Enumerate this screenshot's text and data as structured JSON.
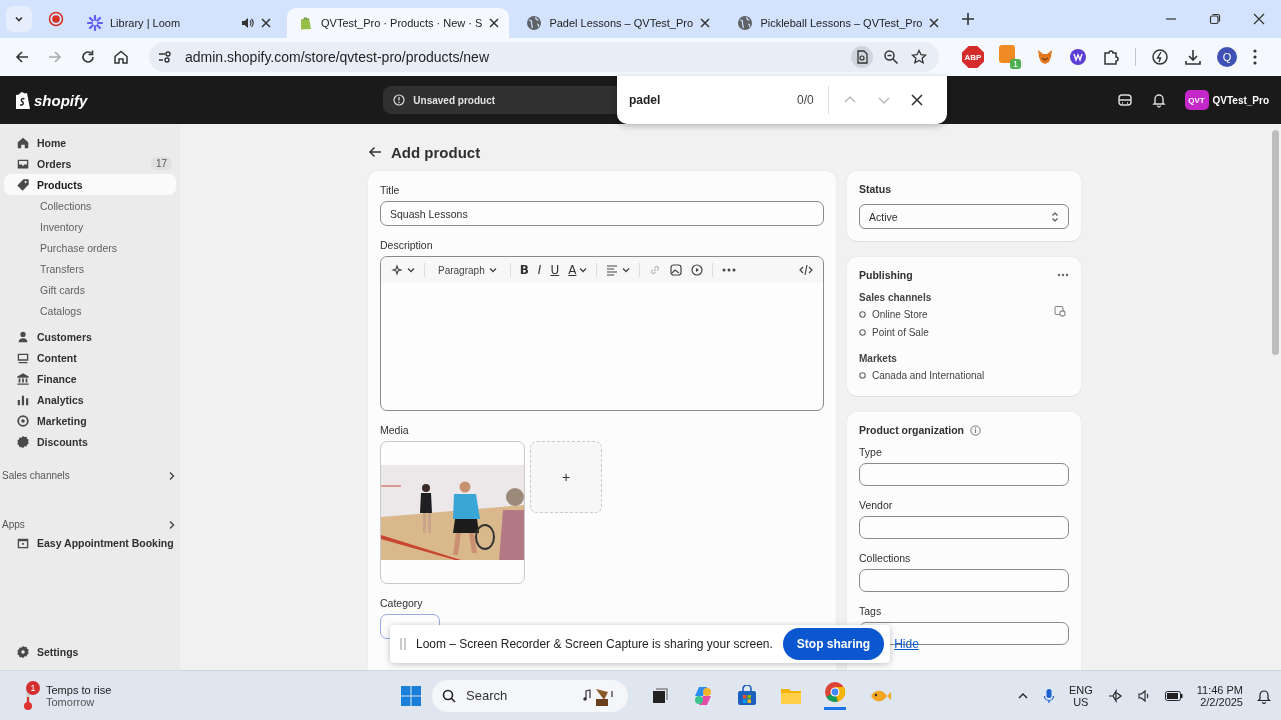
{
  "browser": {
    "tabs": [
      {
        "title": "Library | Loom",
        "kind": "loom",
        "selected": false,
        "audio": true
      },
      {
        "title": "QVTest_Pro · Products · New · S",
        "kind": "shopify",
        "selected": true,
        "audio": false
      },
      {
        "title": "Padel Lessons – QVTest_Pro",
        "kind": "globe",
        "selected": false,
        "audio": false
      },
      {
        "title": "Pickleball Lessons – QVTest_Pro",
        "kind": "globe",
        "selected": false,
        "audio": false
      }
    ],
    "url": "admin.shopify.com/store/qvtest-pro/products/new",
    "abp": "ABP",
    "extension_badge": "1",
    "profile": "Q"
  },
  "find_bar": {
    "query": "padel",
    "count": "0/0"
  },
  "topbar": {
    "logo": "shopify",
    "unsaved": "Unsaved product",
    "store_badge": "QVT",
    "store": "QVTest_Pro"
  },
  "sidebar": {
    "nav": [
      {
        "label": "Home",
        "kind": "main",
        "selected": false
      },
      {
        "label": "Orders",
        "kind": "main",
        "selected": false,
        "badge": "17"
      },
      {
        "label": "Products",
        "kind": "main",
        "selected": true
      },
      {
        "label": "Collections",
        "kind": "sub",
        "selected": false
      },
      {
        "label": "Inventory",
        "kind": "sub",
        "selected": false
      },
      {
        "label": "Purchase orders",
        "kind": "sub",
        "selected": false
      },
      {
        "label": "Transfers",
        "kind": "sub",
        "selected": false
      },
      {
        "label": "Gift cards",
        "kind": "sub",
        "selected": false
      },
      {
        "label": "Catalogs",
        "kind": "sub",
        "selected": false
      },
      {
        "label": "Customers",
        "kind": "main",
        "selected": false
      },
      {
        "label": "Content",
        "kind": "main",
        "selected": false
      },
      {
        "label": "Finance",
        "kind": "main",
        "selected": false
      },
      {
        "label": "Analytics",
        "kind": "main",
        "selected": false
      },
      {
        "label": "Marketing",
        "kind": "main",
        "selected": false
      },
      {
        "label": "Discounts",
        "kind": "main",
        "selected": false
      }
    ],
    "sections": [
      {
        "label": "Sales channels"
      },
      {
        "label": "Apps",
        "items": [
          {
            "label": "Easy Appointment Booking",
            "selected": false
          }
        ]
      }
    ],
    "settings": "Settings"
  },
  "page": {
    "title": "Add product"
  },
  "product": {
    "title_label": "Title",
    "title_value": "Squash Lessons",
    "description_label": "Description",
    "block_format": "Paragraph",
    "format_buttons": [
      "B",
      "I",
      "U",
      "A"
    ],
    "media_label": "Media",
    "add_media": "+",
    "category_label": "Category"
  },
  "status": {
    "label": "Status",
    "value": "Active"
  },
  "publishing": {
    "title": "Publishing",
    "channels_label": "Sales channels",
    "channels": [
      "Online Store",
      "Point of Sale"
    ],
    "markets_label": "Markets",
    "markets": [
      "Canada and International"
    ]
  },
  "organization": {
    "title": "Product organization",
    "fields": [
      "Type",
      "Vendor",
      "Collections",
      "Tags"
    ]
  },
  "loom_bar": {
    "message": "Loom – Screen Recorder & Screen Capture is sharing your screen.",
    "stop": "Stop sharing",
    "hide": "Hide"
  },
  "taskbar": {
    "weather_badge": "1",
    "weather_title": "Temps to rise",
    "weather_sub": "Tomorrow",
    "search": "Search",
    "lang": "ENG",
    "region": "US",
    "time": "11:46 PM",
    "date": "2/2/2025"
  }
}
